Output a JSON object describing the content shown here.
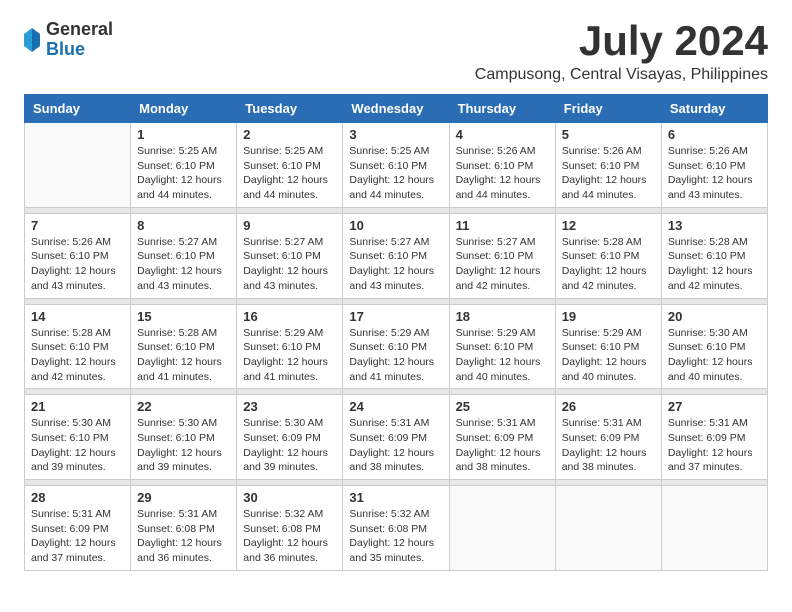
{
  "header": {
    "logo_general": "General",
    "logo_blue": "Blue",
    "month": "July 2024",
    "location": "Campusong, Central Visayas, Philippines"
  },
  "weekdays": [
    "Sunday",
    "Monday",
    "Tuesday",
    "Wednesday",
    "Thursday",
    "Friday",
    "Saturday"
  ],
  "weeks": [
    [
      {
        "day": "",
        "info": ""
      },
      {
        "day": "1",
        "info": "Sunrise: 5:25 AM\nSunset: 6:10 PM\nDaylight: 12 hours\nand 44 minutes."
      },
      {
        "day": "2",
        "info": "Sunrise: 5:25 AM\nSunset: 6:10 PM\nDaylight: 12 hours\nand 44 minutes."
      },
      {
        "day": "3",
        "info": "Sunrise: 5:25 AM\nSunset: 6:10 PM\nDaylight: 12 hours\nand 44 minutes."
      },
      {
        "day": "4",
        "info": "Sunrise: 5:26 AM\nSunset: 6:10 PM\nDaylight: 12 hours\nand 44 minutes."
      },
      {
        "day": "5",
        "info": "Sunrise: 5:26 AM\nSunset: 6:10 PM\nDaylight: 12 hours\nand 44 minutes."
      },
      {
        "day": "6",
        "info": "Sunrise: 5:26 AM\nSunset: 6:10 PM\nDaylight: 12 hours\nand 43 minutes."
      }
    ],
    [
      {
        "day": "7",
        "info": "Sunrise: 5:26 AM\nSunset: 6:10 PM\nDaylight: 12 hours\nand 43 minutes."
      },
      {
        "day": "8",
        "info": "Sunrise: 5:27 AM\nSunset: 6:10 PM\nDaylight: 12 hours\nand 43 minutes."
      },
      {
        "day": "9",
        "info": "Sunrise: 5:27 AM\nSunset: 6:10 PM\nDaylight: 12 hours\nand 43 minutes."
      },
      {
        "day": "10",
        "info": "Sunrise: 5:27 AM\nSunset: 6:10 PM\nDaylight: 12 hours\nand 43 minutes."
      },
      {
        "day": "11",
        "info": "Sunrise: 5:27 AM\nSunset: 6:10 PM\nDaylight: 12 hours\nand 42 minutes."
      },
      {
        "day": "12",
        "info": "Sunrise: 5:28 AM\nSunset: 6:10 PM\nDaylight: 12 hours\nand 42 minutes."
      },
      {
        "day": "13",
        "info": "Sunrise: 5:28 AM\nSunset: 6:10 PM\nDaylight: 12 hours\nand 42 minutes."
      }
    ],
    [
      {
        "day": "14",
        "info": "Sunrise: 5:28 AM\nSunset: 6:10 PM\nDaylight: 12 hours\nand 42 minutes."
      },
      {
        "day": "15",
        "info": "Sunrise: 5:28 AM\nSunset: 6:10 PM\nDaylight: 12 hours\nand 41 minutes."
      },
      {
        "day": "16",
        "info": "Sunrise: 5:29 AM\nSunset: 6:10 PM\nDaylight: 12 hours\nand 41 minutes."
      },
      {
        "day": "17",
        "info": "Sunrise: 5:29 AM\nSunset: 6:10 PM\nDaylight: 12 hours\nand 41 minutes."
      },
      {
        "day": "18",
        "info": "Sunrise: 5:29 AM\nSunset: 6:10 PM\nDaylight: 12 hours\nand 40 minutes."
      },
      {
        "day": "19",
        "info": "Sunrise: 5:29 AM\nSunset: 6:10 PM\nDaylight: 12 hours\nand 40 minutes."
      },
      {
        "day": "20",
        "info": "Sunrise: 5:30 AM\nSunset: 6:10 PM\nDaylight: 12 hours\nand 40 minutes."
      }
    ],
    [
      {
        "day": "21",
        "info": "Sunrise: 5:30 AM\nSunset: 6:10 PM\nDaylight: 12 hours\nand 39 minutes."
      },
      {
        "day": "22",
        "info": "Sunrise: 5:30 AM\nSunset: 6:10 PM\nDaylight: 12 hours\nand 39 minutes."
      },
      {
        "day": "23",
        "info": "Sunrise: 5:30 AM\nSunset: 6:09 PM\nDaylight: 12 hours\nand 39 minutes."
      },
      {
        "day": "24",
        "info": "Sunrise: 5:31 AM\nSunset: 6:09 PM\nDaylight: 12 hours\nand 38 minutes."
      },
      {
        "day": "25",
        "info": "Sunrise: 5:31 AM\nSunset: 6:09 PM\nDaylight: 12 hours\nand 38 minutes."
      },
      {
        "day": "26",
        "info": "Sunrise: 5:31 AM\nSunset: 6:09 PM\nDaylight: 12 hours\nand 38 minutes."
      },
      {
        "day": "27",
        "info": "Sunrise: 5:31 AM\nSunset: 6:09 PM\nDaylight: 12 hours\nand 37 minutes."
      }
    ],
    [
      {
        "day": "28",
        "info": "Sunrise: 5:31 AM\nSunset: 6:09 PM\nDaylight: 12 hours\nand 37 minutes."
      },
      {
        "day": "29",
        "info": "Sunrise: 5:31 AM\nSunset: 6:08 PM\nDaylight: 12 hours\nand 36 minutes."
      },
      {
        "day": "30",
        "info": "Sunrise: 5:32 AM\nSunset: 6:08 PM\nDaylight: 12 hours\nand 36 minutes."
      },
      {
        "day": "31",
        "info": "Sunrise: 5:32 AM\nSunset: 6:08 PM\nDaylight: 12 hours\nand 35 minutes."
      },
      {
        "day": "",
        "info": ""
      },
      {
        "day": "",
        "info": ""
      },
      {
        "day": "",
        "info": ""
      }
    ]
  ]
}
